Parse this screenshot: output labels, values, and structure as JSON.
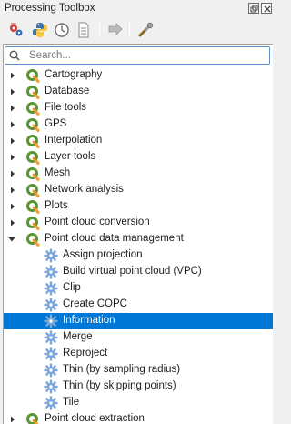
{
  "window": {
    "title": "Processing Toolbox"
  },
  "search": {
    "placeholder": "Search..."
  },
  "groups": [
    {
      "label": "Cartography"
    },
    {
      "label": "Database"
    },
    {
      "label": "File tools"
    },
    {
      "label": "GPS"
    },
    {
      "label": "Interpolation"
    },
    {
      "label": "Layer tools"
    },
    {
      "label": "Mesh"
    },
    {
      "label": "Network analysis"
    },
    {
      "label": "Plots"
    },
    {
      "label": "Point cloud conversion"
    },
    {
      "label": "Point cloud data management"
    },
    {
      "label": "Point cloud extraction"
    }
  ],
  "algorithms": [
    {
      "label": "Assign projection"
    },
    {
      "label": "Build virtual point cloud (VPC)"
    },
    {
      "label": "Clip"
    },
    {
      "label": "Create COPC"
    },
    {
      "label": "Information"
    },
    {
      "label": "Merge"
    },
    {
      "label": "Reproject"
    },
    {
      "label": "Thin (by sampling radius)"
    },
    {
      "label": "Thin (by skipping points)"
    },
    {
      "label": "Tile"
    }
  ],
  "selected_algorithm": "Information",
  "colors": {
    "selection": "#0078d7",
    "qgis_green": "#589632",
    "gear_blue": "#7ba6d8"
  }
}
